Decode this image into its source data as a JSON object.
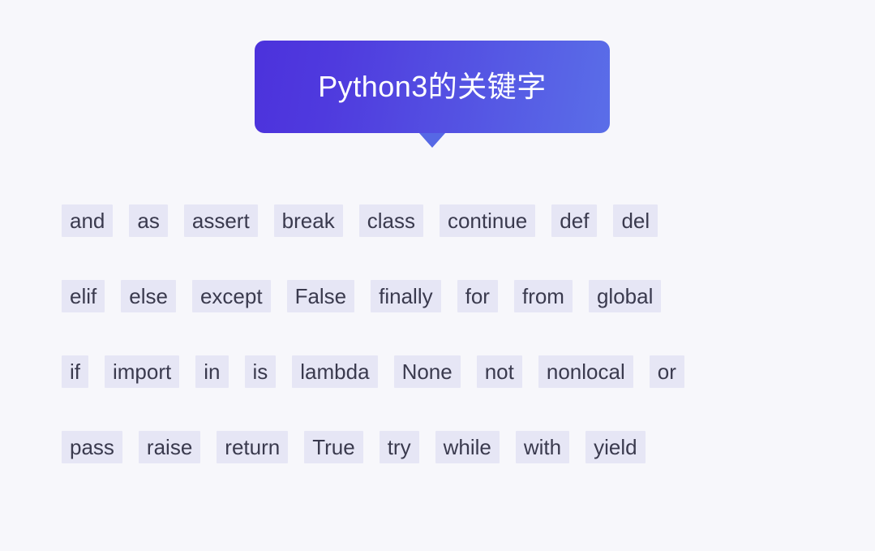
{
  "page": {
    "background_color": "#f7f7fb"
  },
  "banner": {
    "title": "Python3的关键字",
    "gradient_start": "#4c32dc",
    "gradient_end": "#5a6ee8",
    "title_color": "#ffffff",
    "tail_color": "#5668e5"
  },
  "keywords": {
    "chip_background": "#e6e6f5",
    "chip_text_color": "#3a3a4e",
    "total_count": 33,
    "rows": [
      [
        "and",
        "as",
        "assert",
        "break",
        "class",
        "continue",
        "def",
        "del"
      ],
      [
        "elif",
        "else",
        "except",
        "False",
        "finally",
        "for",
        "from",
        "global"
      ],
      [
        "if",
        "import",
        "in",
        "is",
        "lambda",
        "None",
        "not",
        "nonlocal",
        "or"
      ],
      [
        "pass",
        "raise",
        "return",
        "True",
        "try",
        "while",
        "with",
        "yield"
      ]
    ]
  }
}
